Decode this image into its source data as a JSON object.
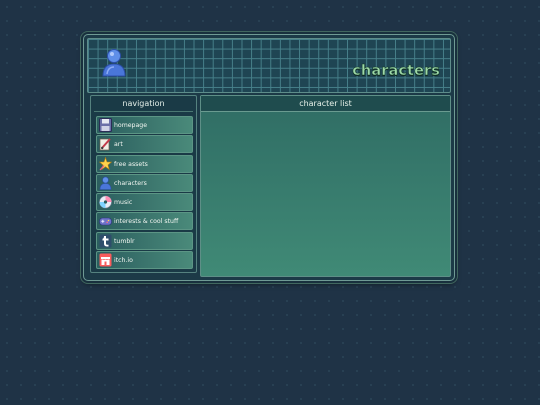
{
  "page": {
    "title": "characters"
  },
  "navigation": {
    "title": "navigation",
    "items": [
      {
        "label": "homepage",
        "icon": "floppy-disk-icon"
      },
      {
        "label": "art",
        "icon": "paint-brush-icon"
      },
      {
        "label": "free assets",
        "icon": "star-wand-icon"
      },
      {
        "label": "characters",
        "icon": "person-icon"
      },
      {
        "label": "music",
        "icon": "cd-disc-icon"
      },
      {
        "label": "interests & cool stuff",
        "icon": "gamepad-icon"
      },
      {
        "label": "tumblr",
        "icon": "tumblr-icon"
      },
      {
        "label": "itch.io",
        "icon": "itchio-icon"
      }
    ]
  },
  "main": {
    "title": "character list"
  },
  "colors": {
    "background": "#1f3346",
    "title_text": "#9ed9a8",
    "panel": "#408a76"
  }
}
